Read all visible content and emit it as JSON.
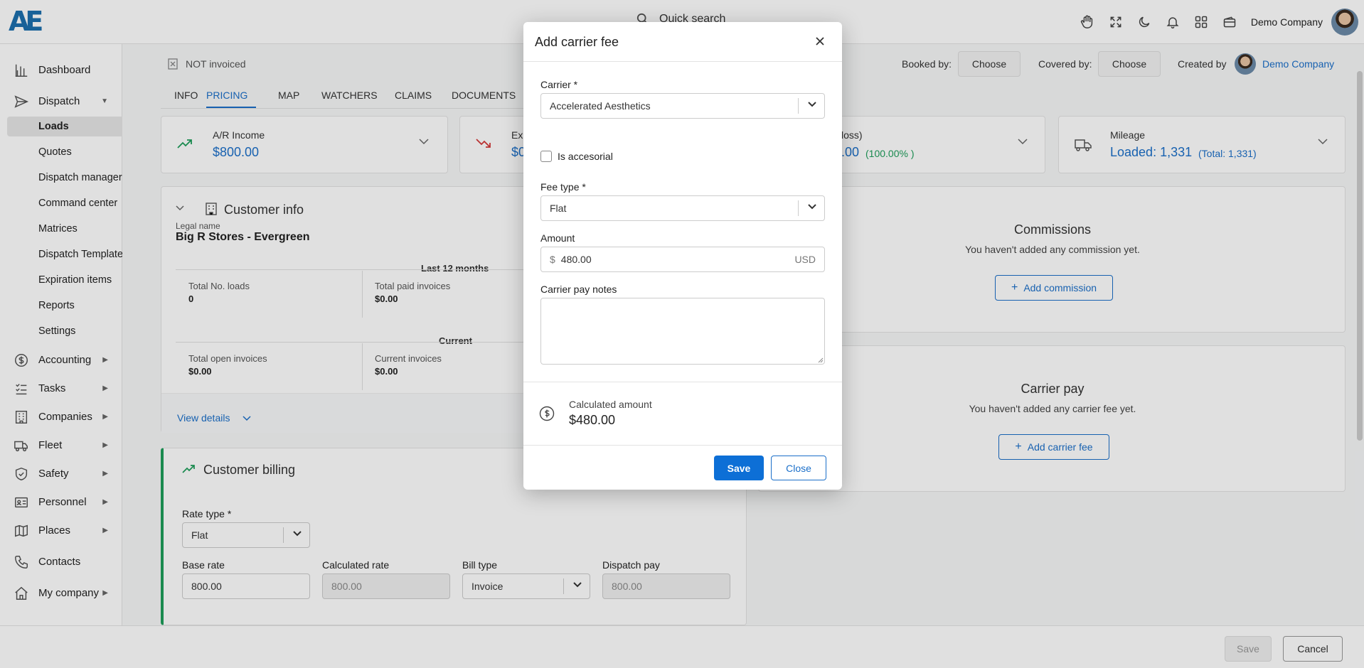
{
  "topbar": {
    "logo_text": "AE",
    "search_placeholder": "Quick search",
    "company_name": "Demo Company",
    "icons": [
      "hand-icon",
      "fullscreen-icon",
      "moon-icon",
      "bell-icon",
      "apps-grid-icon",
      "wallet-icon"
    ]
  },
  "sidebar": {
    "items": [
      {
        "label": "Dashboard",
        "icon": "bar-chart-icon"
      },
      {
        "label": "Dispatch",
        "icon": "send-icon",
        "arrow": "▼"
      },
      {
        "label": "Accounting",
        "icon": "dollar-circle-icon",
        "arrow": "▶"
      },
      {
        "label": "Tasks",
        "icon": "tasks-icon",
        "arrow": "▶"
      },
      {
        "label": "Companies",
        "icon": "building-icon",
        "arrow": "▶"
      },
      {
        "label": "Fleet",
        "icon": "truck-icon",
        "arrow": "▶"
      },
      {
        "label": "Safety",
        "icon": "shield-icon",
        "arrow": "▶"
      },
      {
        "label": "Personnel",
        "icon": "id-card-icon",
        "arrow": "▶"
      },
      {
        "label": "Places",
        "icon": "map-icon",
        "arrow": "▶"
      },
      {
        "label": "Contacts",
        "icon": "phone-icon"
      },
      {
        "label": "My company",
        "icon": "home-icon",
        "arrow": "▶"
      }
    ],
    "dispatch_sub": [
      "Loads",
      "Quotes",
      "Dispatch manager",
      "Command center",
      "Matrices",
      "Dispatch Templates",
      "Expiration items",
      "Reports",
      "Settings"
    ]
  },
  "load": {
    "invoice_status": "NOT invoiced",
    "booked_by_label": "Booked by:",
    "covered_by_label": "Covered by:",
    "choose": "Choose",
    "created_by_label": "Created by",
    "created_by": "Demo Company",
    "tabs": [
      "INFO",
      "PRICING",
      "MAP",
      "WATCHERS",
      "CLAIMS",
      "DOCUMENTS"
    ],
    "active_tab": "PRICING"
  },
  "summary": {
    "ar_income_label": "A/R Income",
    "ar_income_value": "$800.00",
    "expense_label": "Ex",
    "expense_value": "$0",
    "profit_label": "loss)",
    "profit_value": ".00",
    "profit_pct": "(100.00% )",
    "mileage_label": "Mileage",
    "mileage_value": "Loaded: 1,331",
    "mileage_total": "(Total: 1,331)"
  },
  "customer_info": {
    "title": "Customer info",
    "legal_name_label": "Legal name",
    "legal_name": "Big R Stores - Evergreen",
    "last12_label": "Last 12 months",
    "total_loads_label": "Total No. loads",
    "total_loads": "0",
    "total_paid_label": "Total paid invoices",
    "total_paid": "$0.00",
    "current_label": "Current",
    "open_inv_label": "Total open invoices",
    "open_inv": "$0.00",
    "current_inv_label": "Current invoices",
    "current_inv": "$0.00",
    "view_details": "View details"
  },
  "billing": {
    "title": "Customer billing",
    "rate_type_label": "Rate type *",
    "rate_type": "Flat",
    "base_rate_label": "Base rate",
    "base_rate": "800.00",
    "calc_rate_label": "Calculated rate",
    "calc_rate": "800.00",
    "bill_type_label": "Bill type",
    "bill_type": "Invoice",
    "dispatch_pay_label": "Dispatch pay",
    "dispatch_pay": "800.00"
  },
  "commissions": {
    "title": "Commissions",
    "empty": "You haven't added any commission yet.",
    "add": "Add commission"
  },
  "carrier_pay": {
    "title": "Carrier pay",
    "empty": "You haven't added any carrier fee yet.",
    "add": "Add carrier fee"
  },
  "footer": {
    "save": "Save",
    "cancel": "Cancel"
  },
  "modal": {
    "title": "Add carrier fee",
    "carrier_label": "Carrier *",
    "carrier_value": "Accelerated Aesthetics",
    "accessorial_label": "Is accesorial",
    "accessorial_checked": false,
    "fee_type_label": "Fee type *",
    "fee_type_value": "Flat",
    "amount_label": "Amount",
    "currency_symbol": "$",
    "amount_value": "480.00",
    "currency_code": "USD",
    "notes_label": "Carrier pay notes",
    "notes_value": "",
    "calc_label": "Calculated amount",
    "calc_value": "$480.00",
    "save": "Save",
    "close": "Close"
  },
  "colors": {
    "accent": "#1b6fc9",
    "green": "#1e9e5a",
    "red": "#d43a3a",
    "primary_btn": "#0d6fd6"
  }
}
